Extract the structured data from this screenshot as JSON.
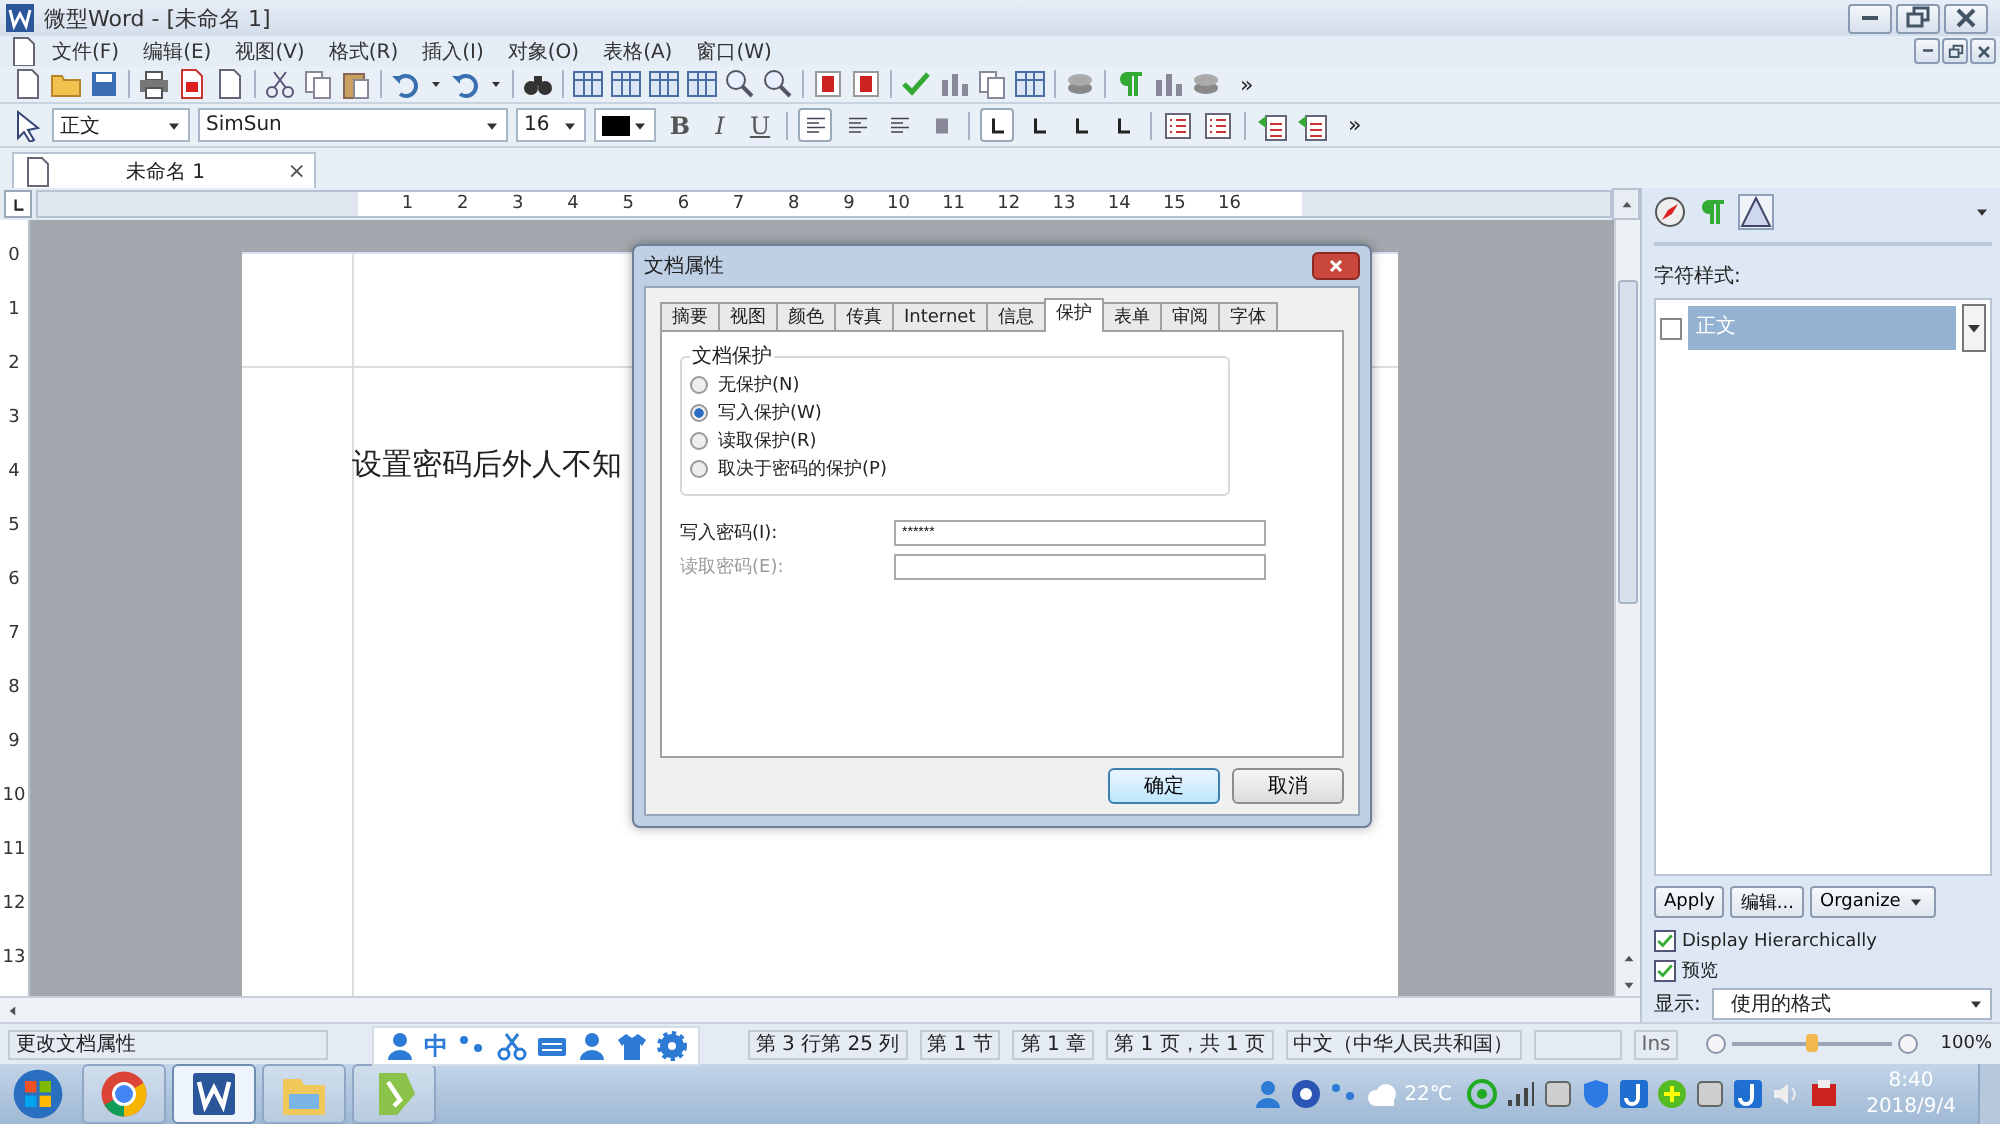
{
  "window": {
    "title": "微型Word - [未命名 1]"
  },
  "menu": [
    "文件(F)",
    "编辑(E)",
    "视图(V)",
    "格式(R)",
    "插入(I)",
    "对象(O)",
    "表格(A)",
    "窗口(W)"
  ],
  "toolbar": {
    "overflow": "»"
  },
  "format_bar": {
    "style": "正文",
    "font": "SimSun",
    "size": "16",
    "overflow": "»",
    "text_buttons": [
      {
        "label": "B",
        "kind": "bold"
      },
      {
        "label": "I",
        "kind": "italic"
      },
      {
        "label": "U",
        "kind": "underline"
      }
    ],
    "align_buttons": [
      {
        "selected": true
      },
      {
        "selected": false
      },
      {
        "selected": false
      },
      {
        "selected": false
      }
    ],
    "tab_stops": [
      {
        "selected": true
      },
      {
        "selected": false
      },
      {
        "selected": false
      },
      {
        "selected": false
      }
    ]
  },
  "doc_tabs": [
    {
      "label": "未命名 1",
      "selected": true,
      "close": "×"
    }
  ],
  "ruler": {
    "h_marks": [
      "1",
      "2",
      "3",
      "4",
      "5",
      "6",
      "7",
      "8",
      "9",
      "10",
      "11",
      "12",
      "13",
      "14",
      "15",
      "16"
    ],
    "v_marks": [
      "0",
      "1",
      "2",
      "3",
      "4",
      "5",
      "6",
      "7",
      "8",
      "9",
      "10",
      "11",
      "12",
      "13"
    ]
  },
  "document": {
    "text": "设置密码后外人不知"
  },
  "dialog": {
    "title": "文档属性",
    "tabs": [
      {
        "label": "摘要",
        "selected": false
      },
      {
        "label": "视图",
        "selected": false
      },
      {
        "label": "颜色",
        "selected": false
      },
      {
        "label": "传真",
        "selected": false
      },
      {
        "label": "Internet",
        "selected": false
      },
      {
        "label": "信息",
        "selected": false
      },
      {
        "label": "保护",
        "selected": true
      },
      {
        "label": "表单",
        "selected": false
      },
      {
        "label": "审阅",
        "selected": false
      },
      {
        "label": "字体",
        "selected": false
      }
    ],
    "group_title": "文档保护",
    "options": [
      {
        "label": "无保护(N)",
        "selected": false
      },
      {
        "label": "写入保护(W)",
        "selected": true
      },
      {
        "label": "读取保护(R)",
        "selected": false
      },
      {
        "label": "取决于密码的保护(P)",
        "selected": false
      }
    ],
    "fields": [
      {
        "label": "写入密码(I):",
        "value": "******",
        "disabled": false
      },
      {
        "label": "读取密码(E):",
        "disabled": true
      }
    ],
    "buttons": [
      {
        "label": "确定",
        "default": true
      },
      {
        "label": "取消",
        "default": false
      }
    ]
  },
  "styles_panel": {
    "heading": "字符样式:",
    "items": [
      {
        "label": "正文",
        "selected": true,
        "checked": false
      }
    ],
    "buttons": [
      "Apply",
      "编辑...",
      "Organize"
    ],
    "options": [
      {
        "label": "Display Hierarchically",
        "checked": true
      },
      {
        "label": "预览",
        "checked": true
      }
    ],
    "show_label": "显示:",
    "show_value": "使用的格式"
  },
  "status_bar": {
    "message": "更改文档属性",
    "cells": [
      "第 3 行第 25 列",
      "第 1 节",
      "第 1 章",
      "第 1 页，共 1 页",
      "中文（中华人民共和国）",
      ""
    ],
    "ins": "Ins",
    "zoom": {
      "level": 0.5,
      "reading": "100%"
    }
  },
  "ime_bar": {
    "mode": "中"
  },
  "taskbar": {
    "apps": [
      {
        "selected": false
      },
      {
        "selected": true
      },
      {
        "selected": false
      },
      {
        "selected": false
      }
    ],
    "weather": "22℃",
    "time": "8:40",
    "date": "2018/9/4"
  }
}
